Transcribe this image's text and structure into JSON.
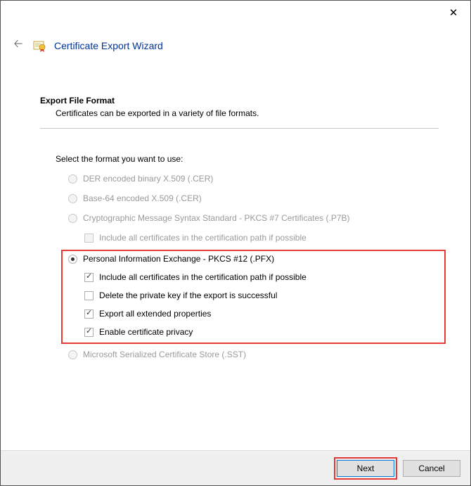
{
  "window": {
    "title": "Certificate Export Wizard"
  },
  "page": {
    "heading": "Export File Format",
    "subheading": "Certificates can be exported in a variety of file formats.",
    "selectLabel": "Select the format you want to use:"
  },
  "options": {
    "der": "DER encoded binary X.509 (.CER)",
    "b64": "Base-64 encoded X.509 (.CER)",
    "p7b": "Cryptographic Message Syntax Standard - PKCS #7 Certificates (.P7B)",
    "p7b_include": "Include all certificates in the certification path if possible",
    "pfx": "Personal Information Exchange - PKCS #12 (.PFX)",
    "pfx_include": "Include all certificates in the certification path if possible",
    "pfx_delete": "Delete the private key if the export is successful",
    "pfx_extended": "Export all extended properties",
    "pfx_privacy": "Enable certificate privacy",
    "sst": "Microsoft Serialized Certificate Store (.SST)"
  },
  "buttons": {
    "next": "Next",
    "cancel": "Cancel"
  }
}
